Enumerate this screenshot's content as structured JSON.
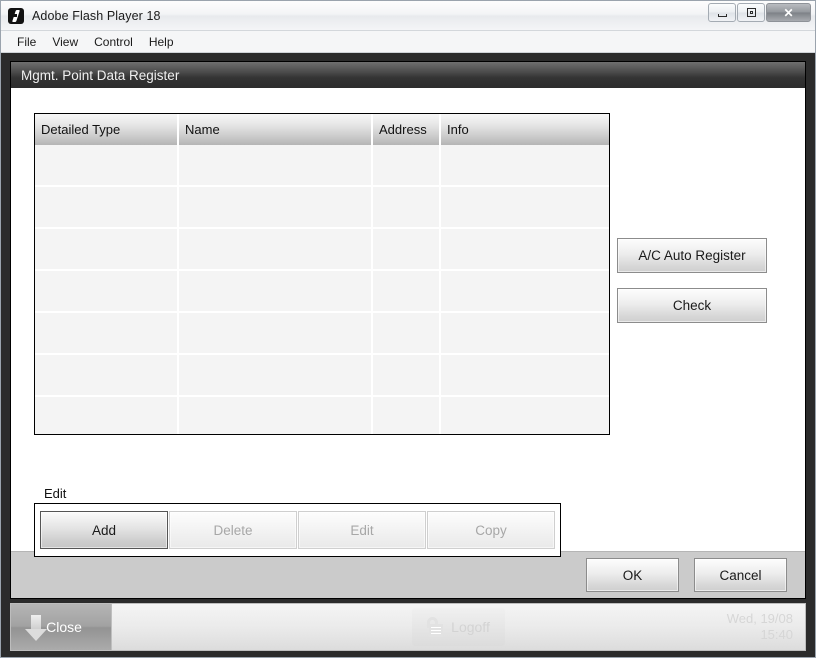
{
  "window": {
    "title": "Adobe Flash Player 18",
    "icon": "flash-icon",
    "controls": {
      "minimize": "minimize-icon",
      "restore": "restore-icon",
      "close": "✕"
    }
  },
  "menubar": {
    "items": [
      {
        "label": "File"
      },
      {
        "label": "View"
      },
      {
        "label": "Control"
      },
      {
        "label": "Help"
      }
    ]
  },
  "dialog": {
    "header_title": "Mgmt. Point Data Register",
    "table": {
      "columns": [
        "Detailed Type",
        "Name",
        "Address",
        "Info"
      ],
      "rows": [
        [
          "",
          "",
          "",
          ""
        ],
        [
          "",
          "",
          "",
          ""
        ],
        [
          "",
          "",
          "",
          ""
        ],
        [
          "",
          "",
          "",
          ""
        ],
        [
          "",
          "",
          "",
          ""
        ],
        [
          "",
          "",
          "",
          ""
        ],
        [
          "",
          "",
          "",
          ""
        ]
      ]
    },
    "side_buttons": [
      {
        "label": "A/C Auto Register",
        "enabled": true
      },
      {
        "label": "Check",
        "enabled": true
      }
    ],
    "edit_section": {
      "label": "Edit",
      "buttons": [
        {
          "label": "Add",
          "enabled": true
        },
        {
          "label": "Delete",
          "enabled": false
        },
        {
          "label": "Edit",
          "enabled": false
        },
        {
          "label": "Copy",
          "enabled": false
        }
      ]
    },
    "footer_buttons": [
      {
        "label": "OK"
      },
      {
        "label": "Cancel"
      }
    ]
  },
  "taskbar": {
    "close_label": "Close",
    "close_icon": "arrow-down-icon",
    "logoff_label": "Logoff",
    "logoff_icon": "unlocked-padlock-icon",
    "date": "Wed, 19/08",
    "time": "15:40"
  },
  "colors": {
    "stage_bg": "#2b2b2b",
    "dialog_header": "#3a3a3a",
    "footer_bg": "#cbcbcb"
  }
}
